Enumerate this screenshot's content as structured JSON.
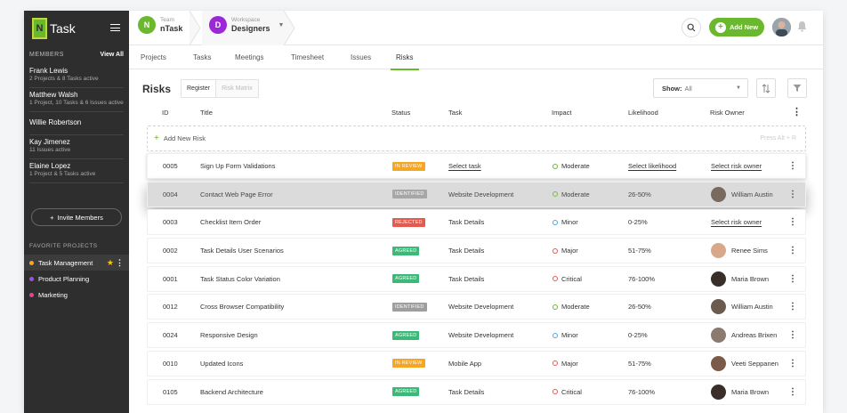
{
  "brand": {
    "name": "Task",
    "logo_text": "N"
  },
  "sidebar": {
    "members_label": "MEMBERS",
    "view_all": "View All",
    "members": [
      {
        "name": "Frank Lewis",
        "summary": "2 Projects & 8 Tasks active"
      },
      {
        "name": "Matthew Walsh",
        "summary": "1 Project, 10 Tasks & 6 Issues active"
      },
      {
        "name": "Willie Robertson",
        "summary": ""
      },
      {
        "name": "Kay Jimenez",
        "summary": "11 Issues active"
      },
      {
        "name": "Elaine Lopez",
        "summary": "1 Project & 5 Tasks active"
      }
    ],
    "invite_label": "Invite Members",
    "favorites_label": "FAVORITE PROJECTS",
    "favorites": [
      {
        "name": "Task Management",
        "color": "#f5a623"
      },
      {
        "name": "Product Planning",
        "color": "#9b51e0"
      },
      {
        "name": "Marketing",
        "color": "#e84393"
      }
    ]
  },
  "header": {
    "team_label": "Team",
    "team_name": "nTask",
    "team_initial": "N",
    "team_color": "#6ab82e",
    "workspace_label": "Workspace",
    "workspace_name": "Designers",
    "workspace_initial": "D",
    "workspace_color": "#9b27d6",
    "add_new_label": "Add New"
  },
  "tabs": [
    "Projects",
    "Tasks",
    "Meetings",
    "Timesheet",
    "Issues",
    "Risks"
  ],
  "active_tab": "Risks",
  "page": {
    "title": "Risks",
    "view_register": "Register",
    "view_matrix": "Risk Matrix",
    "show_label": "Show:",
    "show_value": "All"
  },
  "table": {
    "columns": {
      "id": "ID",
      "title": "Title",
      "status": "Status",
      "task": "Task",
      "impact": "Impact",
      "likelihood": "Likelihood",
      "owner": "Risk Owner"
    },
    "add_label": "Add New Risk",
    "add_hint": "Press Alt + R",
    "rows": [
      {
        "id": "0005",
        "title": "Sign Up Form Validations",
        "status": "IN REVIEW",
        "status_color": "#f5a623",
        "task": "Select task",
        "task_link": true,
        "impact": "Moderate",
        "impact_color": "#6ab82e",
        "likelihood": "Select likelihood",
        "likelihood_link": true,
        "owner": "Select risk owner",
        "owner_link": true,
        "avatar": ""
      },
      {
        "id": "0004",
        "title": "Contact Web Page Error",
        "status": "IDENTIFIED",
        "status_color": "#9e9e9e",
        "task": "Website Development",
        "task_link": false,
        "impact": "Moderate",
        "impact_color": "#6ab82e",
        "likelihood": "26-50%",
        "likelihood_link": false,
        "owner": "William Austin",
        "owner_link": false,
        "avatar": "#6b5a4e"
      },
      {
        "id": "0003",
        "title": "Checklist Item Order",
        "status": "REJECTED",
        "status_color": "#e55a4e",
        "task": "Task Details",
        "task_link": false,
        "impact": "Minor",
        "impact_color": "#4aa8e0",
        "likelihood": "0-25%",
        "likelihood_link": false,
        "owner": "Select risk owner",
        "owner_link": true,
        "avatar": ""
      },
      {
        "id": "0002",
        "title": "Task Details User Scenarios",
        "status": "AGREED",
        "status_color": "#3cb878",
        "task": "Task Details",
        "task_link": false,
        "impact": "Major",
        "impact_color": "#e55a4e",
        "likelihood": "51-75%",
        "likelihood_link": false,
        "owner": "Renee Sims",
        "owner_link": false,
        "avatar": "#d9a88a"
      },
      {
        "id": "0001",
        "title": "Task Status Color Variation",
        "status": "AGREED",
        "status_color": "#3cb878",
        "task": "Task Details",
        "task_link": false,
        "impact": "Critical",
        "impact_color": "#e55a4e",
        "likelihood": "76-100%",
        "likelihood_link": false,
        "owner": "Maria Brown",
        "owner_link": false,
        "avatar": "#3a2e2a"
      },
      {
        "id": "0012",
        "title": "Cross Browser Compatibility",
        "status": "IDENTIFIED",
        "status_color": "#9e9e9e",
        "task": "Website Development",
        "task_link": false,
        "impact": "Moderate",
        "impact_color": "#6ab82e",
        "likelihood": "26-50%",
        "likelihood_link": false,
        "owner": "William Austin",
        "owner_link": false,
        "avatar": "#6b5a4e"
      },
      {
        "id": "0024",
        "title": "Responsive Design",
        "status": "AGREED",
        "status_color": "#3cb878",
        "task": "Website Development",
        "task_link": false,
        "impact": "Minor",
        "impact_color": "#4aa8e0",
        "likelihood": "0-25%",
        "likelihood_link": false,
        "owner": "Andreas Brixen",
        "owner_link": false,
        "avatar": "#8a7a70"
      },
      {
        "id": "0010",
        "title": "Updated Icons",
        "status": "IN REVIEW",
        "status_color": "#f5a623",
        "task": "Mobile App",
        "task_link": false,
        "impact": "Major",
        "impact_color": "#e55a4e",
        "likelihood": "51-75%",
        "likelihood_link": false,
        "owner": "Veeti Seppanen",
        "owner_link": false,
        "avatar": "#7a5a48"
      },
      {
        "id": "0105",
        "title": "Backend Architecture",
        "status": "AGREED",
        "status_color": "#3cb878",
        "task": "Task Details",
        "task_link": false,
        "impact": "Critical",
        "impact_color": "#e55a4e",
        "likelihood": "76-100%",
        "likelihood_link": false,
        "owner": "Maria Brown",
        "owner_link": false,
        "avatar": "#3a2e2a"
      }
    ]
  }
}
